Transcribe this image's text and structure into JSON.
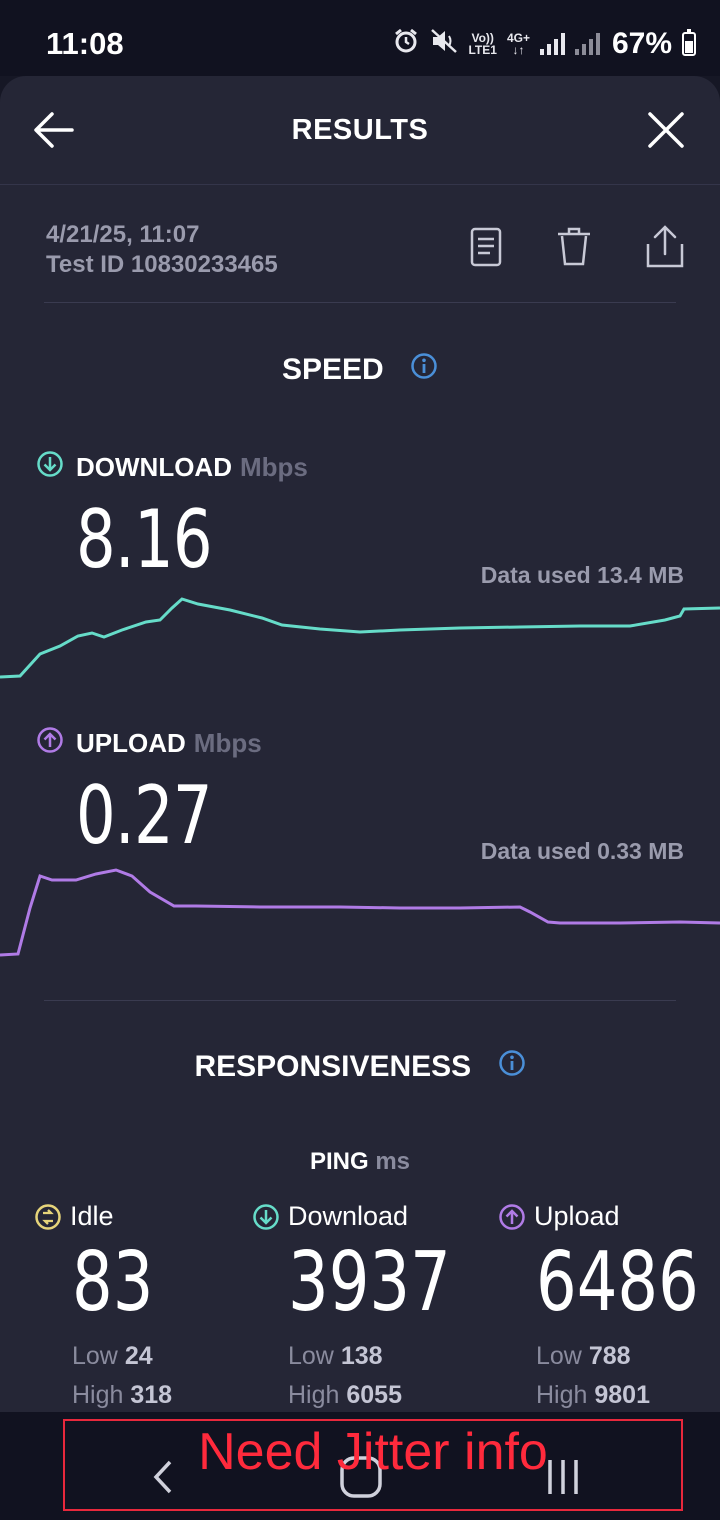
{
  "status_bar": {
    "time": "11:08",
    "network_top": "4G+",
    "volte_top": "Vo))",
    "volte_bottom": "LTE1",
    "battery_percent": "67%"
  },
  "header": {
    "title": "RESULTS"
  },
  "test_info": {
    "datetime": "4/21/25, 11:07",
    "test_id": "Test ID 10830233465"
  },
  "speed": {
    "section_title": "SPEED",
    "download": {
      "label": "DOWNLOAD",
      "unit": "Mbps",
      "value": "8.16",
      "data_used": "Data used 13.4 MB"
    },
    "upload": {
      "label": "UPLOAD",
      "unit": "Mbps",
      "value": "0.27",
      "data_used": "Data used 0.33 MB"
    }
  },
  "responsiveness": {
    "section_title": "RESPONSIVENESS",
    "ping_label": "PING",
    "ping_unit": "ms",
    "columns": [
      {
        "label": "Idle",
        "value": "83",
        "low_label": "Low",
        "low": "24",
        "high_label": "High",
        "high": "318"
      },
      {
        "label": "Download",
        "value": "3937",
        "low_label": "Low",
        "low": "138",
        "high_label": "High",
        "high": "6055"
      },
      {
        "label": "Upload",
        "value": "6486",
        "low_label": "Low",
        "low": "788",
        "high_label": "High",
        "high": "9801"
      }
    ]
  },
  "annotation": {
    "text": "Need Jitter info"
  },
  "colors": {
    "download": "#66dcc9",
    "upload": "#b07be6",
    "idle": "#e6d47a",
    "info": "#4a8fd8",
    "annotation": "#ff2a3c"
  }
}
